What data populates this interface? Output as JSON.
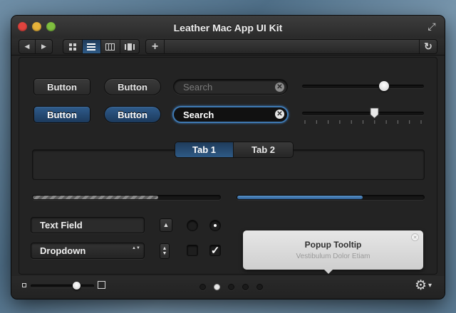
{
  "window": {
    "title": "Leather Mac App UI Kit"
  },
  "toolbar": {
    "back_glyph": "◀",
    "forward_glyph": "▶",
    "add_glyph": "+",
    "reload_glyph": "↻",
    "fullscreen_glyph": "⤢",
    "view_modes": [
      "grid-icon",
      "list-icon",
      "columns-icon",
      "coverflow-icon"
    ],
    "active_view": "list"
  },
  "buttons": {
    "button1": "Button",
    "button2": "Button",
    "button3": "Button",
    "button4": "Button"
  },
  "search": {
    "placeholder": "Search",
    "active_value": "Search",
    "clear_glyph": "✕"
  },
  "sliders": {
    "slider1_value": 0.67,
    "slider2_value": 0.59,
    "ticks": 11
  },
  "tabs": {
    "tab1": "Tab 1",
    "tab2": "Tab 2",
    "selected": "Tab 1"
  },
  "progress": {
    "striped_value": 0.67,
    "blue_value": 0.67
  },
  "form": {
    "text_field": "Text Field",
    "dropdown": "Dropdown",
    "dropdown_arrow": "▲▼",
    "up_glyph": "▲",
    "stepper_glyph": "▲▼",
    "check_glyph": "✓"
  },
  "tooltip": {
    "title": "Popup Tooltip",
    "subtitle": "Vestibulum Dolor Etiam",
    "close_glyph": "✕"
  },
  "bottom": {
    "zoom_value": 0.72,
    "page_dots": 5,
    "current_page": 2,
    "gear_glyph": "⚙",
    "menu_arrow": "▾"
  },
  "colors": {
    "accent_blue": "#2f5c8c",
    "progress_blue": "#3a73ad",
    "close_red": "#e0443e",
    "minimize_yellow": "#e6b23a",
    "zoom_green": "#7fbf3f"
  }
}
